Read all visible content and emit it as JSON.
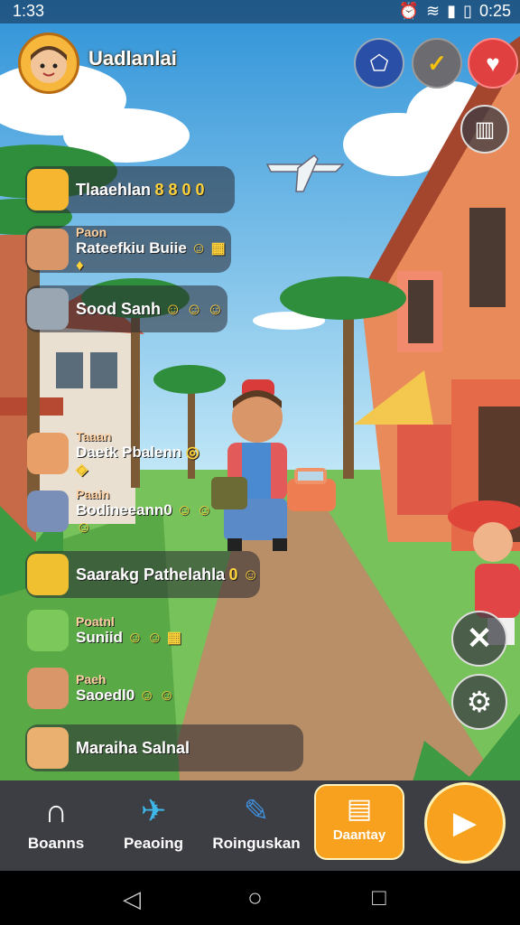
{
  "status": {
    "time": "1:33",
    "clock": "0:25"
  },
  "header": {
    "player_name": "Uadlanlai"
  },
  "chat": [
    {
      "line1": "",
      "line2": "Tlaaehlan",
      "emoji": "8 8 0 0"
    },
    {
      "line1": "Paon",
      "line2": "Rateefkiu Buiie",
      "emoji": "☺ ▦ ♦"
    },
    {
      "line1": "",
      "line2": "Sood Sanh",
      "emoji": "☺ ☺ ☺"
    },
    {
      "line1": "Taaan",
      "line2": "Daetk Pbalenn",
      "emoji": "◎ ◈"
    },
    {
      "line1": "Paain",
      "line2": "Bodineeann0",
      "emoji": "☺ ☺ ☺"
    },
    {
      "line1": "",
      "line2": "Saarakg Pathelahla",
      "emoji": "0 ☺"
    },
    {
      "line1": "Poatnl",
      "line2": "Suniid",
      "emoji": "☺ ☺ ▦"
    },
    {
      "line1": "Paeh",
      "line2": "Saoedl0",
      "emoji": "☺ ☺"
    },
    {
      "line1": "",
      "line2": "Maraiha Salnal",
      "emoji": ""
    }
  ],
  "nav": [
    {
      "label": "Boanns"
    },
    {
      "label": "Peaoing"
    },
    {
      "label": "Roinguskan"
    },
    {
      "label": "Daantay"
    }
  ],
  "colors": {
    "sky": "#4fb1e6",
    "road": "#b88f66",
    "nav_bg": "#3d3d44",
    "accent": "#f7a11e"
  }
}
